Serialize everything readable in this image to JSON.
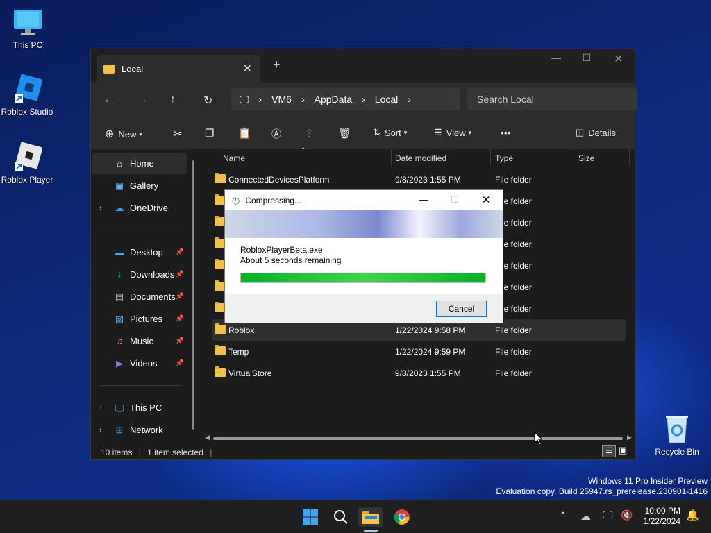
{
  "desktop": {
    "icons": [
      {
        "label": "This PC"
      },
      {
        "label": "Roblox Studio"
      },
      {
        "label": "Roblox Player"
      },
      {
        "label": "Recycle Bin"
      }
    ],
    "watermark": {
      "line1": "Windows 11 Pro Insider Preview",
      "line2": "Evaluation copy. Build 25947.rs_prerelease.230901-1416"
    }
  },
  "explorer": {
    "tab_title": "Local",
    "breadcrumbs": [
      "VM6",
      "AppData",
      "Local"
    ],
    "search_placeholder": "Search Local",
    "toolbar": {
      "new_label": "New",
      "sort_label": "Sort",
      "view_label": "View",
      "more_label": "•••",
      "details_label": "Details"
    },
    "sidebar": {
      "home": "Home",
      "gallery": "Gallery",
      "onedrive": "OneDrive",
      "desktop": "Desktop",
      "downloads": "Downloads",
      "documents": "Documents",
      "pictures": "Pictures",
      "music": "Music",
      "videos": "Videos",
      "thispc": "This PC",
      "network": "Network"
    },
    "columns": {
      "name": "Name",
      "date": "Date modified",
      "type": "Type",
      "size": "Size"
    },
    "rows": [
      {
        "name": "ConnectedDevicesPlatform",
        "date": "9/8/2023 1:55 PM",
        "type": "File folder"
      },
      {
        "name": "",
        "date": "",
        "type": "File folder"
      },
      {
        "name": "",
        "date": "",
        "type": "File folder"
      },
      {
        "name": "",
        "date": "",
        "type": "File folder"
      },
      {
        "name": "",
        "date": "",
        "type": "File folder"
      },
      {
        "name": "",
        "date": "",
        "type": "File folder"
      },
      {
        "name": "",
        "date": "",
        "type": "File folder"
      },
      {
        "name": "Roblox",
        "date": "1/22/2024 9:58 PM",
        "type": "File folder"
      },
      {
        "name": "Temp",
        "date": "1/22/2024 9:59 PM",
        "type": "File folder"
      },
      {
        "name": "VirtualStore",
        "date": "9/8/2023 1:55 PM",
        "type": "File folder"
      }
    ],
    "status": {
      "count": "10 items",
      "selected": "1 item selected"
    }
  },
  "dialog": {
    "title": "Compressing...",
    "filename": "RobloxPlayerBeta.exe",
    "remaining": "About 5 seconds remaining",
    "progress": 1.0,
    "cancel_label": "Cancel"
  },
  "taskbar": {
    "time": "10:00 PM",
    "date": "1/22/2024"
  },
  "colors": {
    "progress": "#06b025",
    "folder": "#f2c04a",
    "accent": "#0078d7"
  }
}
